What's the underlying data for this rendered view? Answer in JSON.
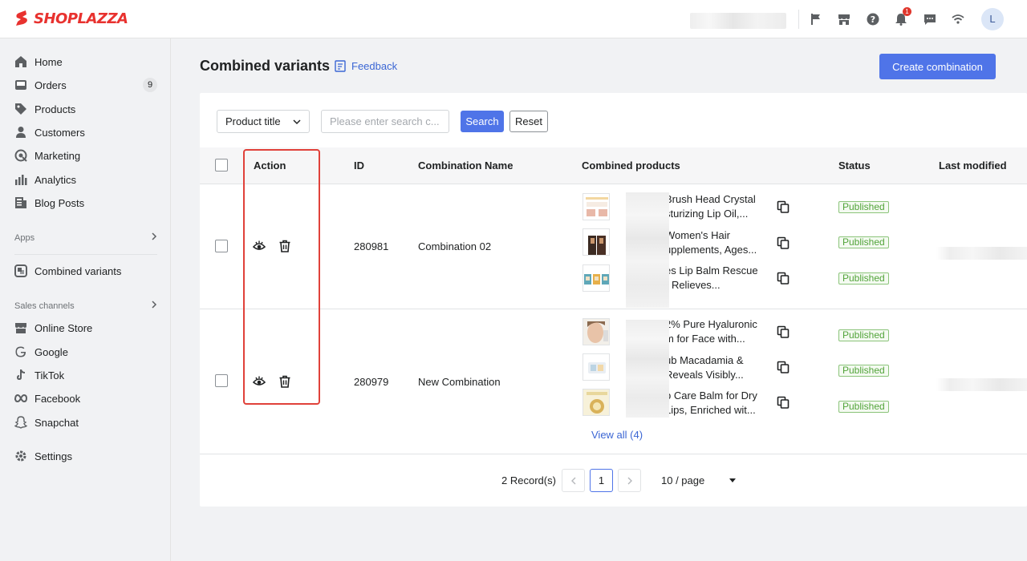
{
  "brand": {
    "name": "SHOPLAZZA"
  },
  "topbar": {
    "notification_count": "1",
    "avatar_initial": "L"
  },
  "sidebar": {
    "items": [
      {
        "label": "Home",
        "icon": "home-icon"
      },
      {
        "label": "Orders",
        "icon": "orders-icon",
        "count": "9"
      },
      {
        "label": "Products",
        "icon": "tag-icon"
      },
      {
        "label": "Customers",
        "icon": "person-icon"
      },
      {
        "label": "Marketing",
        "icon": "marketing-icon"
      },
      {
        "label": "Analytics",
        "icon": "analytics-icon"
      },
      {
        "label": "Blog Posts",
        "icon": "blog-icon"
      }
    ],
    "apps_label": "Apps",
    "apps_items": [
      {
        "label": "Combined variants",
        "icon": "app-icon"
      }
    ],
    "sales_channels_label": "Sales channels",
    "channels": [
      {
        "label": "Online Store",
        "icon": "store-icon"
      },
      {
        "label": "Google",
        "icon": "google-icon"
      },
      {
        "label": "TikTok",
        "icon": "tiktok-icon"
      },
      {
        "label": "Facebook",
        "icon": "facebook-icon"
      },
      {
        "label": "Snapchat",
        "icon": "snapchat-icon"
      }
    ],
    "settings_label": "Settings"
  },
  "page": {
    "title": "Combined variants",
    "feedback_label": "Feedback",
    "create_button": "Create combination"
  },
  "filters": {
    "select_value": "Product title",
    "search_placeholder": "Please enter search c...",
    "search_button": "Search",
    "reset_button": "Reset"
  },
  "table": {
    "headers": {
      "action": "Action",
      "id": "ID",
      "name": "Combination Name",
      "products": "Combined products",
      "status": "Status",
      "modified": "Last modified"
    },
    "rows": [
      {
        "id": "280981",
        "name": "Combination 02",
        "products": [
          {
            "line1": "Brush Head Crystal",
            "line2": "sturizing Lip Oil,...",
            "status": "Published"
          },
          {
            "line1": "Women's Hair",
            "line2": "upplements, Ages...",
            "status": "Published"
          },
          {
            "line1": "es Lip Balm Rescue",
            "line2": "- Relieves...",
            "status": "Published"
          }
        ]
      },
      {
        "id": "280979",
        "name": "New Combination",
        "products": [
          {
            "line1": "2% Pure Hyaluronic",
            "line2": "m for Face with...",
            "status": "Published"
          },
          {
            "line1": "ub Macadamia &",
            "line2": "Reveals Visibly...",
            "status": "Published"
          },
          {
            "line1": "p Care Balm for Dry",
            "line2": "Lips, Enriched wit...",
            "status": "Published"
          }
        ],
        "view_all": "View all (4)"
      }
    ]
  },
  "pagination": {
    "records": "2 Record(s)",
    "current_page": "1",
    "per_page": "10 / page"
  },
  "colors": {
    "primary": "#4f74e8",
    "brand": "#e8322f",
    "published": "#52a43a",
    "highlight": "#e0413a"
  }
}
